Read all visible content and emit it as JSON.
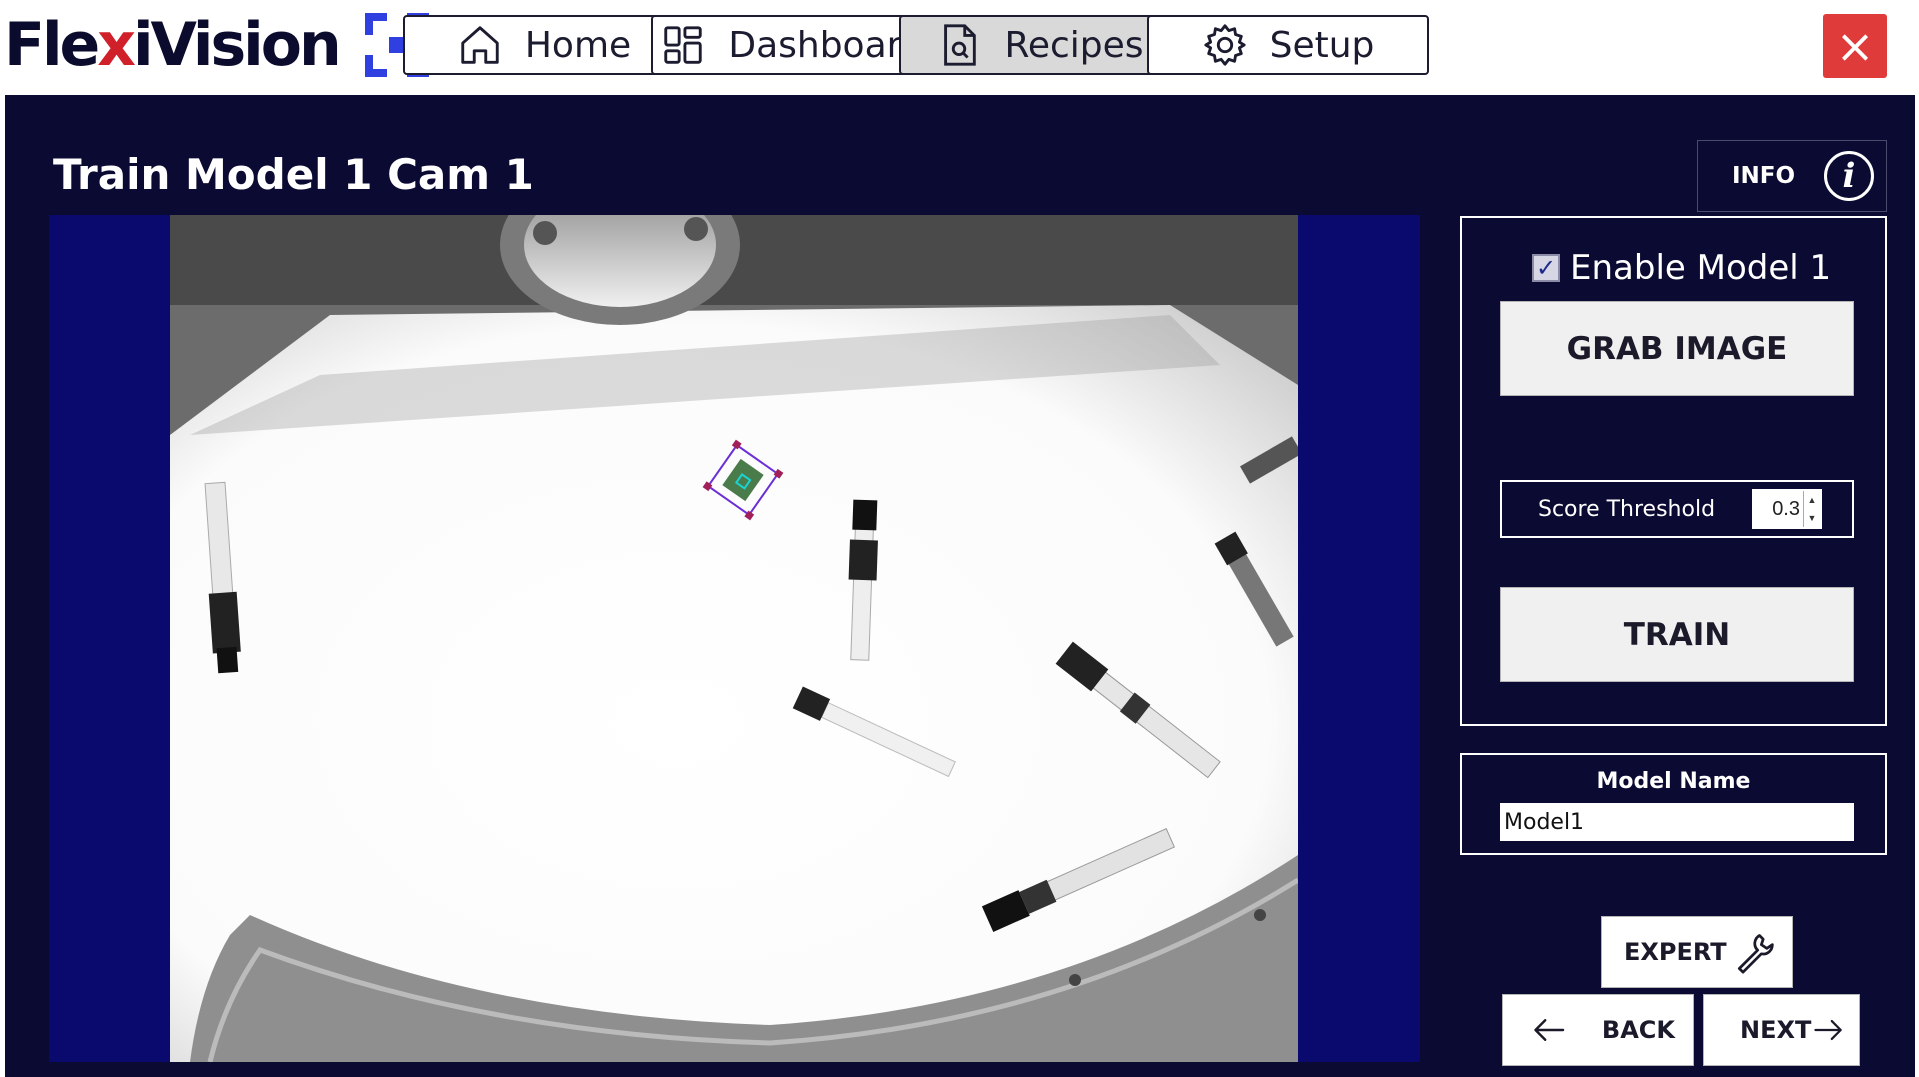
{
  "app": {
    "logo_text_a": "Fle",
    "logo_text_x": "x",
    "logo_text_b": "iVision"
  },
  "nav": [
    {
      "label": "Home",
      "icon": "home-icon"
    },
    {
      "label": "Dashboard",
      "icon": "dashboard-icon"
    },
    {
      "label": "Recipes",
      "icon": "recipe-document-icon",
      "active": true
    },
    {
      "label": "Setup",
      "icon": "gear-icon"
    }
  ],
  "close_icon": "×",
  "page": {
    "title": "Train Model 1 Cam 1"
  },
  "info": {
    "label": "INFO",
    "icon_glyph": "i"
  },
  "model": {
    "enable_label": "Enable Model 1",
    "enabled": true,
    "grab_label": "GRAB IMAGE",
    "score_label": "Score Threshold",
    "score_value": "0.3",
    "train_label": "TRAIN",
    "name_label": "Model Name",
    "name_value": "Model1"
  },
  "footer": {
    "expert_label": "EXPERT",
    "back_label": "BACK",
    "next_label": "NEXT"
  },
  "colors": {
    "brand_dark": "#0b0b2e",
    "brand_accent": "#d0202a",
    "logo_blue": "#2f3fe0",
    "panel_bg": "#0b0a33",
    "image_bg": "#0a0a6e",
    "close_red": "#e03b3b"
  }
}
